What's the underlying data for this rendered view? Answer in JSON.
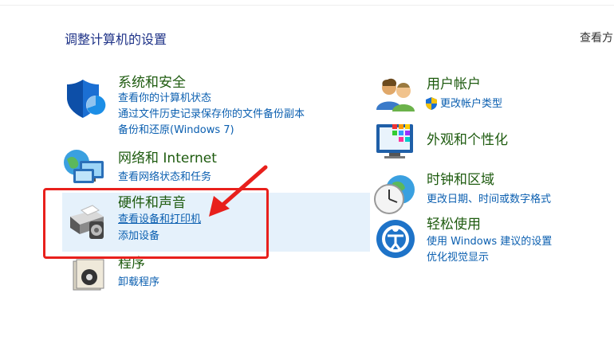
{
  "header": {
    "title": "调整计算机的设置",
    "view_by": "查看方"
  },
  "categories": {
    "security": {
      "title": "系统和安全",
      "links": [
        "查看你的计算机状态",
        "通过文件历史记录保存你的文件备份副本",
        "备份和还原(Windows 7)"
      ]
    },
    "network": {
      "title": "网络和 Internet",
      "links": [
        "查看网络状态和任务"
      ]
    },
    "hardware": {
      "title": "硬件和声音",
      "links": [
        "查看设备和打印机",
        "添加设备"
      ]
    },
    "programs": {
      "title": "程序",
      "links": [
        "卸载程序"
      ]
    },
    "accounts": {
      "title": "用户帐户",
      "links": [
        "更改帐户类型"
      ]
    },
    "appearance": {
      "title": "外观和个性化",
      "links": []
    },
    "clock": {
      "title": "时钟和区域",
      "links": [
        "更改日期、时间或数字格式"
      ]
    },
    "ease": {
      "title": "轻松使用",
      "links": [
        "使用 Windows 建议的设置",
        "优化视觉显示"
      ]
    }
  },
  "colors": {
    "title": "#1e5b0f",
    "link": "#0b5fb0",
    "annotation": "#e8201c",
    "hover": "#e5f1fb"
  }
}
